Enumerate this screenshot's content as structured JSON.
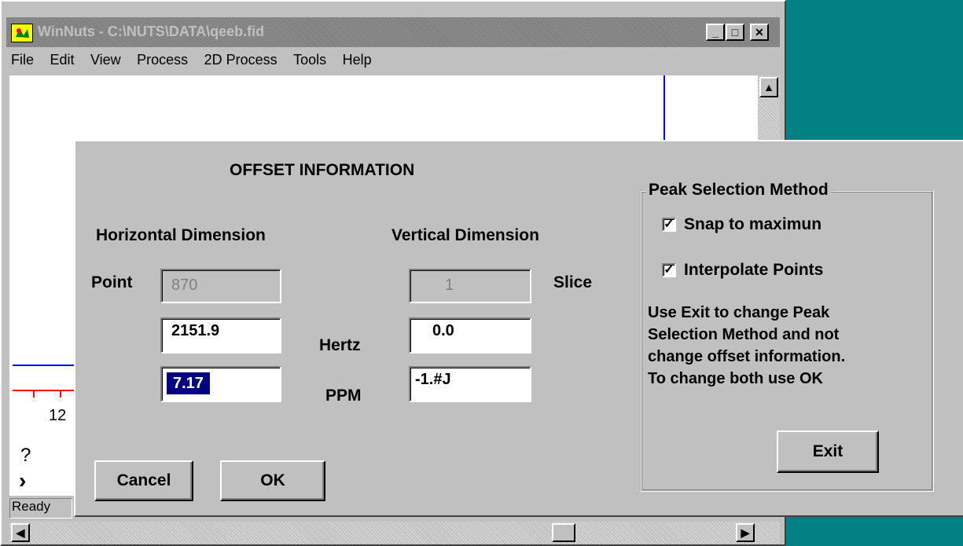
{
  "window": {
    "title": "WinNuts - C:\\NUTS\\DATA\\qeeb.fid",
    "minimize_glyph": "_",
    "maximize_glyph": "□",
    "close_glyph": "✕"
  },
  "menu": {
    "items": [
      {
        "label": "File"
      },
      {
        "label": "Edit"
      },
      {
        "label": "View"
      },
      {
        "label": "Process"
      },
      {
        "label": "2D Process"
      },
      {
        "label": "Tools"
      },
      {
        "label": "Help"
      }
    ]
  },
  "background_plot": {
    "axis_tick_label": "12",
    "help_glyph": "?",
    "arrow_glyph": "›",
    "status_text": "Ready"
  },
  "dialog": {
    "title": "OFFSET INFORMATION",
    "horizontal": {
      "heading": "Horizontal Dimension",
      "point_label": "Point",
      "point_value": "870",
      "hertz_value": "2151.9",
      "ppm_value": "7.17"
    },
    "units": {
      "hertz_label": "Hertz",
      "ppm_label": "PPM"
    },
    "vertical": {
      "heading": "Vertical Dimension",
      "slice_label": "Slice",
      "slice_value": "1",
      "hertz_value": "0.0",
      "ppm_value": "-1.#J"
    },
    "buttons": {
      "cancel": "Cancel",
      "ok": "OK",
      "exit": "Exit"
    },
    "peak_selection": {
      "legend": "Peak Selection Method",
      "snap_label": "Snap to maximun",
      "snap_checked": true,
      "interpolate_label": "Interpolate Points",
      "interpolate_checked": true,
      "help_line1": "Use Exit to change Peak",
      "help_line2": "Selection Method and not",
      "help_line3": "change offset information.",
      "help_line4": "To change both use OK"
    }
  },
  "colors": {
    "desktop": "#008080",
    "titlebar": "#808080",
    "selection": "#000080",
    "plot_blue": "#0000ff",
    "plot_red": "#ff0000"
  }
}
